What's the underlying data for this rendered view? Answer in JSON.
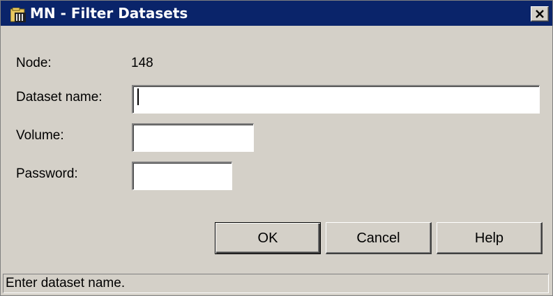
{
  "window": {
    "title": "MN - Filter Datasets",
    "app_icon": "dataset-app-icon",
    "close_icon": "close-icon"
  },
  "form": {
    "node_label": "Node:",
    "node_value": "148",
    "dataset_name_label": "Dataset name:",
    "dataset_name_value": "",
    "volume_label": "Volume:",
    "volume_value": "",
    "password_label": "Password:",
    "password_value": ""
  },
  "buttons": {
    "ok": "OK",
    "cancel": "Cancel",
    "help": "Help"
  },
  "status": {
    "text": "Enter dataset name."
  },
  "colors": {
    "titlebar": "#0a246a",
    "dialog_bg": "#d4d0c8",
    "field_bg": "#ffffff"
  }
}
